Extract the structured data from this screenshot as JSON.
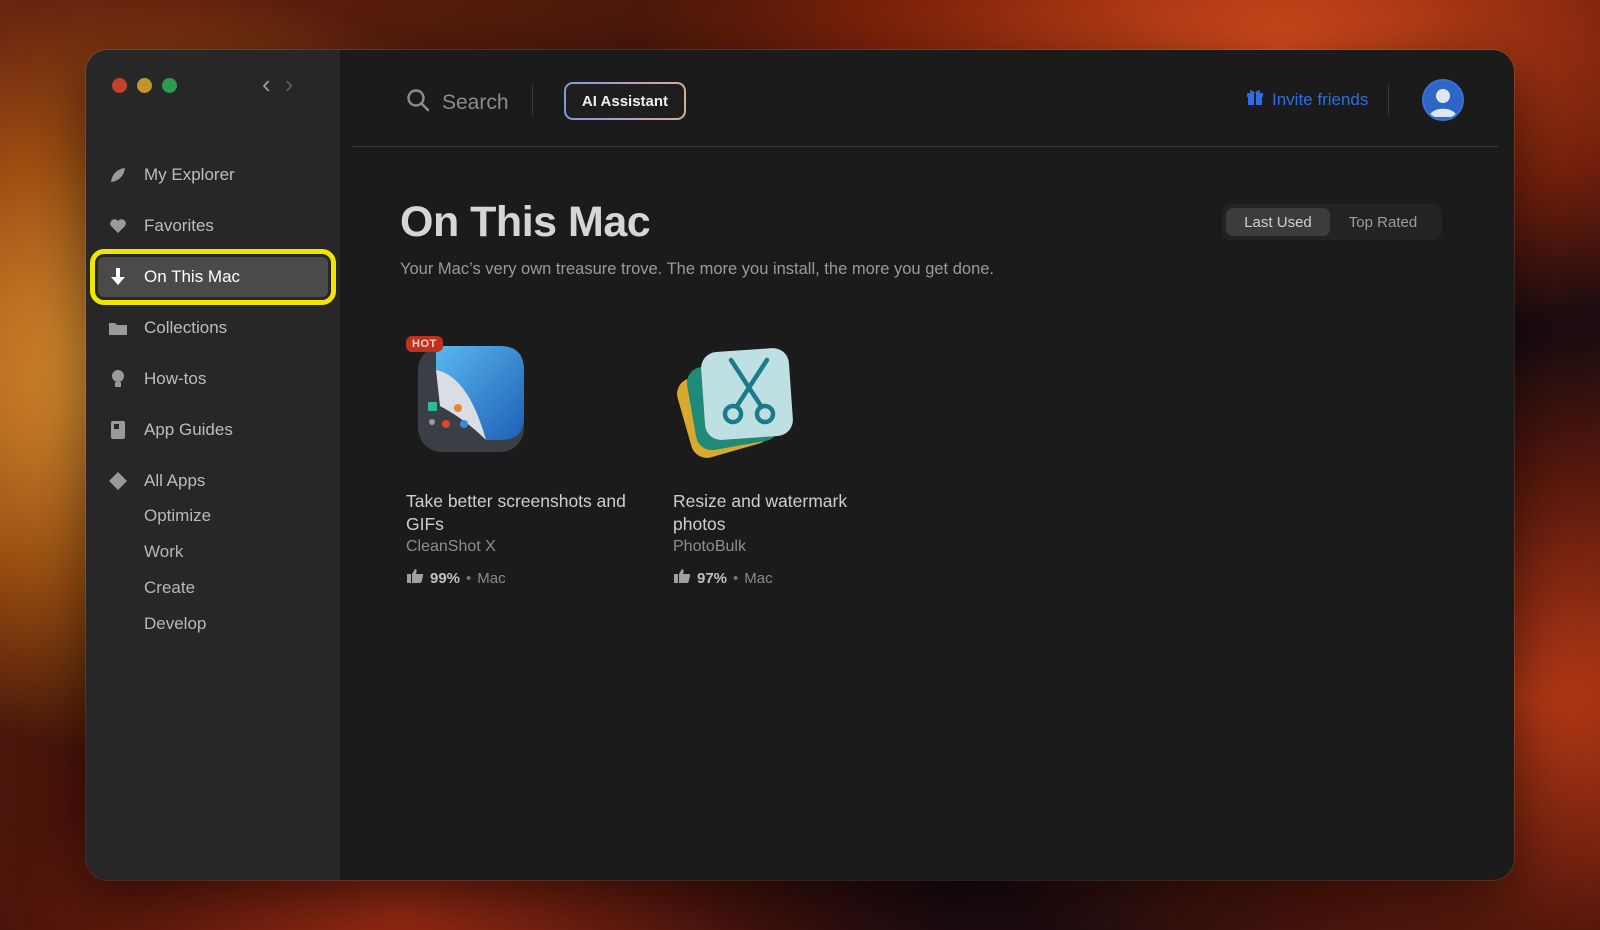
{
  "sidebar": {
    "items": [
      {
        "label": "My Explorer",
        "icon": "leaf-icon"
      },
      {
        "label": "Favorites",
        "icon": "heart-icon"
      },
      {
        "label": "On This Mac",
        "icon": "download-arrow-icon",
        "active": true
      },
      {
        "label": "Collections",
        "icon": "folder-icon"
      },
      {
        "label": "How-tos",
        "icon": "lightbulb-icon"
      },
      {
        "label": "App Guides",
        "icon": "book-icon"
      },
      {
        "label": "All Apps",
        "icon": "diamond-icon"
      }
    ],
    "sub_items": [
      "Optimize",
      "Work",
      "Create",
      "Develop"
    ]
  },
  "header": {
    "search_label": "Search",
    "ai_button": "AI Assistant",
    "invite_label": "Invite friends"
  },
  "main": {
    "title": "On This Mac",
    "subtitle": "Your Mac’s very own treasure trove. The more you install, the more you get done.",
    "sort_options": [
      "Last Used",
      "Top Rated"
    ],
    "selected_sort": "Last Used"
  },
  "apps": [
    {
      "badge": "HOT",
      "title": "Take better screenshots and GIFs",
      "name": "CleanShot X",
      "rating": "99%",
      "bullet": "•",
      "platform": "Mac",
      "icon": "cleanshot-app-icon"
    },
    {
      "badge": "",
      "title": "Resize and watermark photos",
      "name": "PhotoBulk",
      "rating": "97%",
      "bullet": "•",
      "platform": "Mac",
      "icon": "photobulk-app-icon"
    }
  ],
  "colors": {
    "accent_blue": "#2f6ee0",
    "highlight_yellow": "#f2e600",
    "hot_badge": "#c2311e"
  }
}
